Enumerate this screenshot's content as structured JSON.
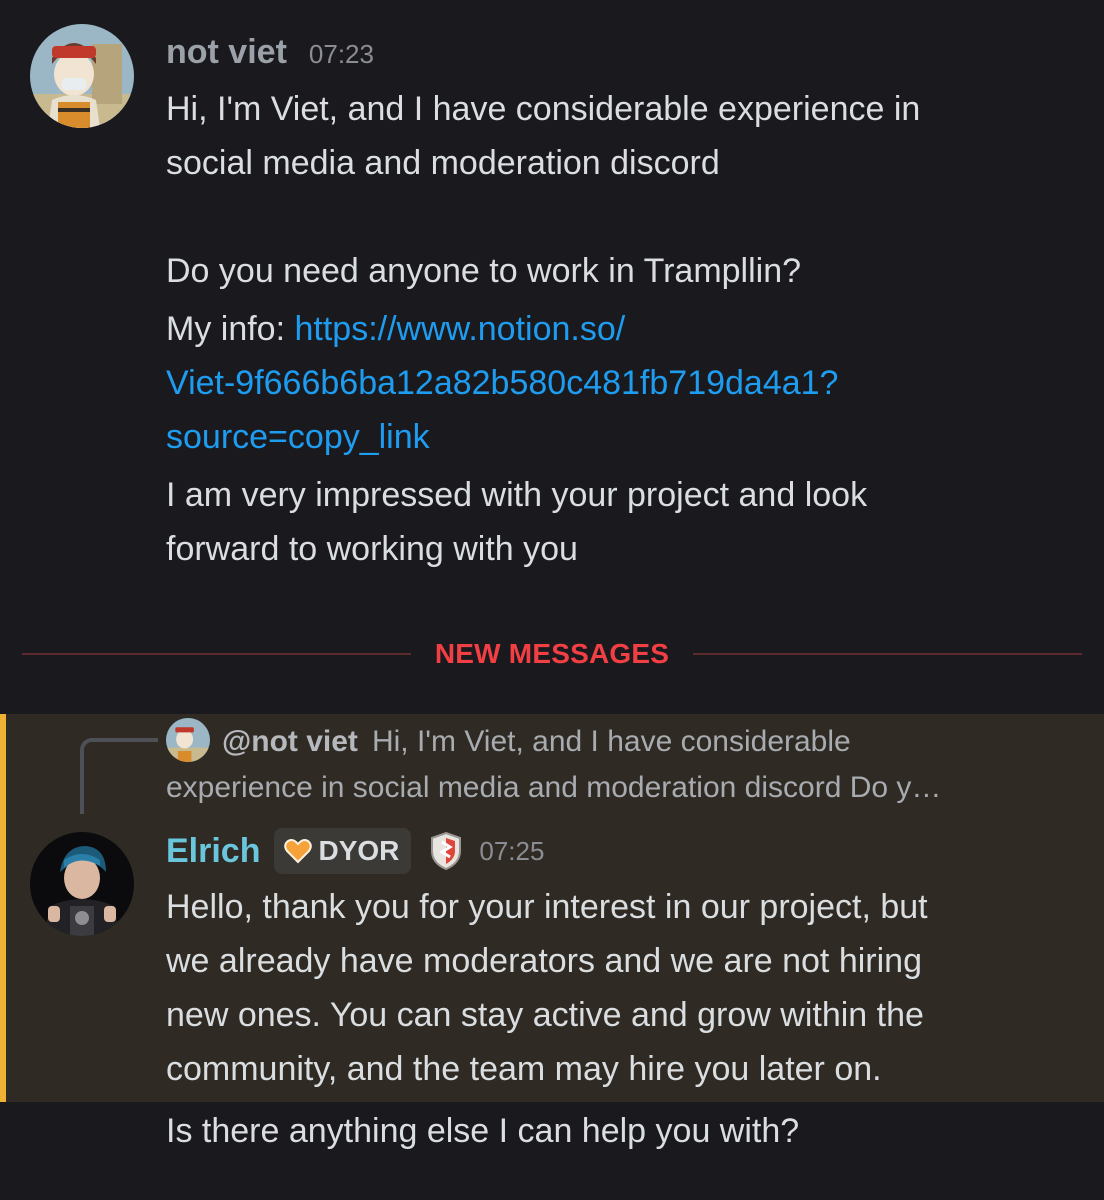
{
  "message1": {
    "author": "not viet",
    "time": "07:23",
    "line1": "Hi, I'm Viet, and I have considerable experience in",
    "line2": "social media and moderation discord",
    "line3": "Do you need anyone to work in Trampllin?",
    "info_prefix": "My info: ",
    "link_part1": "https://www.notion.so/",
    "link_part2": "Viet-9f666b6ba12a82b580c481fb719da4a1?",
    "link_part3": "source=copy_link",
    "line4": "I am very impressed with your project and look",
    "line5": "forward to working with you"
  },
  "divider": {
    "label": "NEW MESSAGES"
  },
  "reply": {
    "author": "@not viet",
    "preview_line1": "Hi, I'm Viet, and I have considerable",
    "preview_line2": "experience in social media and moderation discord  Do y…"
  },
  "message2": {
    "author": "Elrich",
    "tag": "DYOR",
    "time": "07:25",
    "line1": "Hello, thank you for your interest in our project, but",
    "line2": "we already have moderators and we are not hiring",
    "line3": "new ones. You can stay active and grow within the",
    "line4": "community, and the team may hire you later on."
  },
  "message3": {
    "text": "Is there anything else I can help you with?"
  },
  "colors": {
    "background": "#1a1a1e",
    "link": "#1e9cf0",
    "new_messages": "#f23f43",
    "mention_highlight": "#2f2b24",
    "mention_bar": "#f0b232",
    "elrich_name": "#69c6dc"
  }
}
